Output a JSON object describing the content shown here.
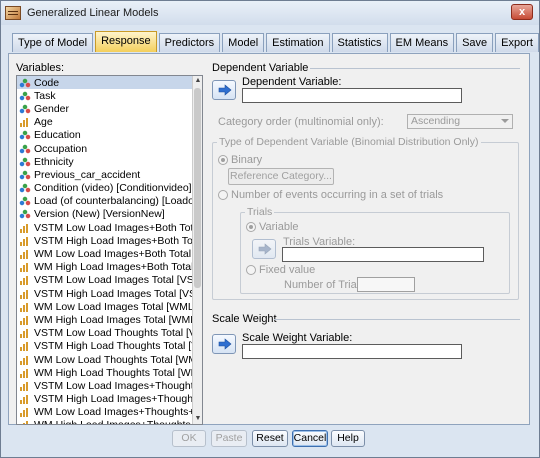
{
  "window": {
    "title": "Generalized Linear Models",
    "close": "x"
  },
  "tabs": [
    {
      "label": "Type of Model"
    },
    {
      "label": "Response"
    },
    {
      "label": "Predictors"
    },
    {
      "label": "Model"
    },
    {
      "label": "Estimation"
    },
    {
      "label": "Statistics"
    },
    {
      "label": "EM Means"
    },
    {
      "label": "Save"
    },
    {
      "label": "Export"
    }
  ],
  "variables": {
    "label": "Variables:",
    "items": [
      {
        "label": "Code",
        "icon": "nominal-icon"
      },
      {
        "label": "Task",
        "icon": "nominal-icon"
      },
      {
        "label": "Gender",
        "icon": "nominal-icon"
      },
      {
        "label": "Age",
        "icon": "scale-icon"
      },
      {
        "label": "Education",
        "icon": "nominal-icon"
      },
      {
        "label": "Occupation",
        "icon": "nominal-icon"
      },
      {
        "label": "Ethnicity",
        "icon": "nominal-icon"
      },
      {
        "label": "Previous_car_accident",
        "icon": "nominal-icon"
      },
      {
        "label": "Condition (video) [Conditionvideo]",
        "icon": "nominal-icon"
      },
      {
        "label": "Load (of counterbalancing) [Loadofco...",
        "icon": "nominal-icon"
      },
      {
        "label": "Version (New) [VersionNew]",
        "icon": "nominal-icon"
      },
      {
        "label": "VSTM Low Load Images+Both Total [...",
        "icon": "scale-icon"
      },
      {
        "label": "VSTM High Load Images+Both Total [...",
        "icon": "scale-icon"
      },
      {
        "label": "WM Low Load Images+Both Total [W...",
        "icon": "scale-icon"
      },
      {
        "label": "WM High Load Images+Both Total [W...",
        "icon": "scale-icon"
      },
      {
        "label": "VSTM Low Load Images Total [VSTM...",
        "icon": "scale-icon"
      },
      {
        "label": "VSTM High Load Images Total [VSTM...",
        "icon": "scale-icon"
      },
      {
        "label": "WM Low Load Images Total [WMLow...",
        "icon": "scale-icon"
      },
      {
        "label": "WM High Load Images Total [WMHig...",
        "icon": "scale-icon"
      },
      {
        "label": "VSTM Low Load Thoughts Total [VST...",
        "icon": "scale-icon"
      },
      {
        "label": "VSTM High Load Thoughts Total [VST...",
        "icon": "scale-icon"
      },
      {
        "label": "WM Low Load Thoughts Total [WMLo...",
        "icon": "scale-icon"
      },
      {
        "label": "WM High Load Thoughts Total [WMHi...",
        "icon": "scale-icon"
      },
      {
        "label": "VSTM Low Load Images+Thoughts+...",
        "icon": "scale-icon"
      },
      {
        "label": "VSTM High Load Images+Thoughts+...",
        "icon": "scale-icon"
      },
      {
        "label": "WM Low Load Images+Thoughts+Bo...",
        "icon": "scale-icon"
      },
      {
        "label": "WM High Load Images+Thoughts+B...",
        "icon": "scale-icon"
      }
    ]
  },
  "dependent": {
    "section_title": "Dependent Variable",
    "field_label": "Dependent Variable:",
    "value": "",
    "category_order_label": "Category order (multinomial only):",
    "category_order_value": "Ascending",
    "binomial_group_title": "Type of Dependent Variable (Binomial Distribution Only)",
    "binary_label": "Binary",
    "reference_button": "Reference Category...",
    "events_label": "Number of events occurring in a set of trials",
    "trials_group_title": "Trials",
    "variable_label": "Variable",
    "trials_variable_label": "Trials Variable:",
    "fixed_value_label": "Fixed value",
    "number_of_trials_label": "Number of Trials:"
  },
  "scale_weight": {
    "section_title": "Scale Weight",
    "field_label": "Scale Weight Variable:",
    "value": ""
  },
  "buttons": {
    "ok": "OK",
    "paste": "Paste",
    "reset": "Reset",
    "cancel": "Cancel",
    "help": "Help"
  },
  "colors": {
    "active_tab": "#f4cf5c",
    "window_bg": "#dbe5f1",
    "selected_row": "#c7d6ea"
  }
}
